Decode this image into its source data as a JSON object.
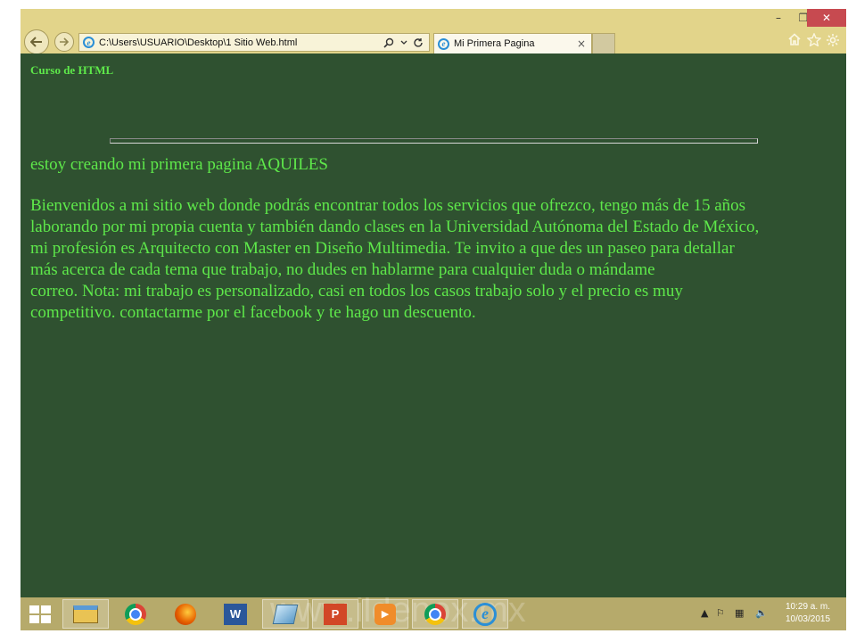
{
  "browser": {
    "address": "C:\\Users\\USUARIO\\Desktop\\1 Sitio Web.html",
    "tab_title": "Mi Primera Pagina",
    "controls": {
      "back": "back-arrow-icon",
      "forward": "forward-arrow-icon",
      "search": "search-icon",
      "refresh": "refresh-icon",
      "tab_close": "×",
      "home": "home-icon",
      "favorites": "star-icon",
      "settings": "gear-icon"
    }
  },
  "window_controls": {
    "minimize": "–",
    "maximize": "❐",
    "close": "✕"
  },
  "page": {
    "header": "Curso de HTML",
    "heading": "estoy creando mi primera pagina AQUILES",
    "body_lines": [
      "Bienvenidos a mi sitio web donde podrás encontrar todos los servicios que ofrezco, tengo más de 15 años",
      "laborando por mi propia cuenta y también dando clases en la Universidad Autónoma del Estado de México,",
      "mi profesión es Arquitecto con Master en Diseño Multimedia.  Te invito a que des un paseo para detallar",
      "más acerca de cada tema que trabajo, no dudes en hablarme para cualquier duda o mándame",
      "correo.  Nota: mi trabajo es personalizado, casi en todos los casos trabajo solo y el precio es muy",
      "competitivo. contactarme por el facebook y te hago un descuento."
    ],
    "background_color": "#2f5130",
    "text_color": "#5ee84a"
  },
  "taskbar": {
    "watermark": "www.ildenox.mx",
    "apps": [
      "file-explorer",
      "chrome",
      "firefox",
      "word",
      "app",
      "powerpoint",
      "media-player",
      "chrome",
      "internet-explorer"
    ],
    "word_icon_letter": "W",
    "ppt_icon_letter": "P",
    "ie_icon_letter": "e",
    "tray": {
      "arrow": "▲",
      "flag": "⚐",
      "network": "▦",
      "volume": "🔈"
    },
    "clock": {
      "time": "10:29 a. m.",
      "date": "10/03/2015"
    }
  }
}
